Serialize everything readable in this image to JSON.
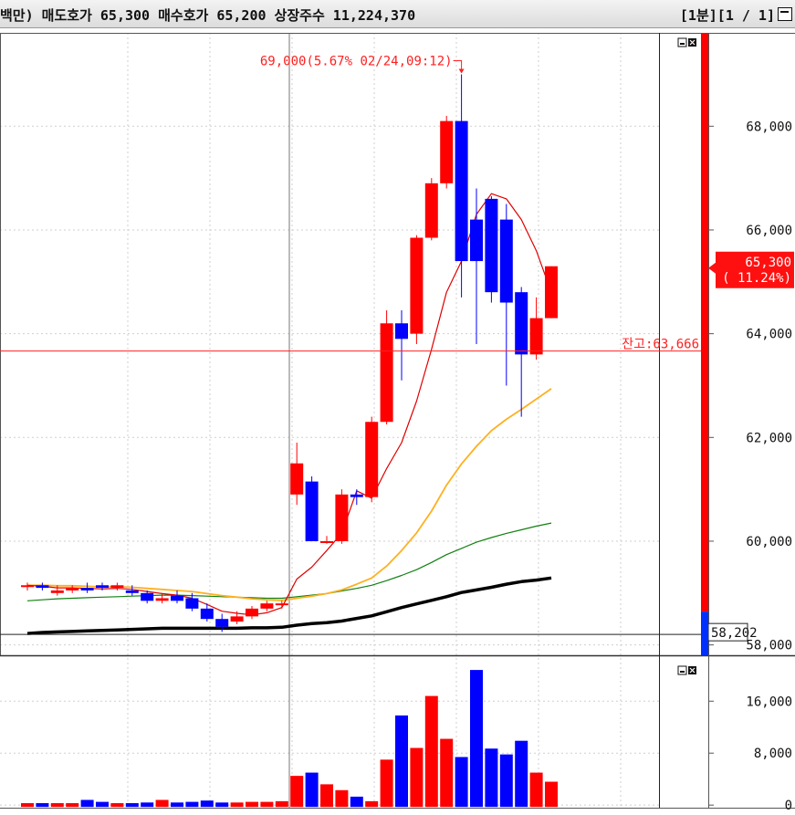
{
  "header": {
    "info": "백만) 매도호가 65,300 매수호가 65,200 상장주수 11,224,370",
    "right": "[1분][1 / 1]"
  },
  "colors": {
    "up": "#ff0000",
    "down": "#0000ff",
    "ma5": "#e00000",
    "ma20": "#ffb020",
    "ma60": "#108010",
    "ma120": "#000000"
  },
  "chart_data": [
    {
      "type": "candlestick",
      "x": [
        1,
        2,
        3,
        4,
        5,
        6,
        7,
        8,
        9,
        10,
        11,
        12,
        13,
        14,
        15,
        16,
        17,
        18,
        19,
        20,
        21,
        22,
        23,
        24,
        25,
        26,
        27,
        28,
        29,
        30,
        31,
        32,
        33,
        34,
        35,
        36
      ],
      "open": [
        59150,
        59150,
        59000,
        59050,
        59100,
        59150,
        59100,
        59050,
        59000,
        58850,
        58950,
        58900,
        58700,
        58500,
        58450,
        58550,
        58700,
        58800,
        60900,
        61150,
        60000,
        60000,
        60900,
        60850,
        62300,
        64200,
        64000,
        65850,
        66900,
        68100,
        66200,
        66600,
        66200,
        64800,
        63600,
        64300
      ],
      "close": [
        59150,
        59100,
        59050,
        59100,
        59050,
        59100,
        59150,
        59000,
        58850,
        58900,
        58850,
        58700,
        58500,
        58350,
        58550,
        58700,
        58800,
        58800,
        61500,
        60000,
        60000,
        60900,
        60850,
        62300,
        64200,
        63900,
        65850,
        66900,
        68100,
        65400,
        65400,
        64800,
        64600,
        63600,
        64300,
        65300
      ],
      "high": [
        59200,
        59200,
        59150,
        59150,
        59200,
        59200,
        59200,
        59150,
        59050,
        59000,
        59050,
        59000,
        58800,
        58600,
        58650,
        58750,
        58850,
        58850,
        61900,
        61250,
        60100,
        61000,
        61000,
        62400,
        64450,
        64450,
        65900,
        67000,
        68200,
        69000,
        66800,
        66650,
        66500,
        64900,
        64700,
        65300
      ],
      "low": [
        59050,
        59050,
        58950,
        59000,
        59000,
        59050,
        59050,
        58950,
        58800,
        58800,
        58800,
        58650,
        58450,
        58250,
        58400,
        58500,
        58650,
        58700,
        60700,
        60000,
        59950,
        59950,
        60700,
        60750,
        62250,
        63100,
        63800,
        65800,
        66800,
        64700,
        63800,
        64600,
        63000,
        62400,
        63500,
        64300
      ],
      "ma5": [
        59150,
        59130,
        59100,
        59100,
        59090,
        59080,
        59090,
        59070,
        59030,
        58990,
        58960,
        58900,
        58780,
        58650,
        58610,
        58580,
        58620,
        58720,
        59270,
        59500,
        59820,
        60150,
        60970,
        60830,
        61400,
        61900,
        62700,
        63700,
        64800,
        65400,
        66300,
        66700,
        66600,
        66200,
        65600,
        64800
      ],
      "ma20": [
        59150,
        59150,
        59140,
        59140,
        59130,
        59120,
        59120,
        59110,
        59090,
        59070,
        59050,
        59030,
        58990,
        58950,
        58920,
        58890,
        58870,
        58860,
        58900,
        58940,
        58990,
        59060,
        59170,
        59290,
        59520,
        59820,
        60160,
        60580,
        61080,
        61490,
        61830,
        62130,
        62350,
        62540,
        62740,
        62940
      ],
      "ma60": [
        58850,
        58870,
        58890,
        58900,
        58910,
        58920,
        58930,
        58940,
        58950,
        58960,
        58960,
        58950,
        58940,
        58930,
        58920,
        58910,
        58900,
        58900,
        58930,
        58960,
        58990,
        59040,
        59090,
        59150,
        59240,
        59340,
        59450,
        59590,
        59740,
        59860,
        59980,
        60070,
        60150,
        60220,
        60290,
        60350
      ],
      "ma120": [
        58220,
        58240,
        58250,
        58260,
        58270,
        58280,
        58290,
        58300,
        58310,
        58320,
        58320,
        58320,
        58320,
        58320,
        58320,
        58330,
        58330,
        58340,
        58380,
        58410,
        58430,
        58460,
        58510,
        58560,
        58640,
        58720,
        58790,
        58860,
        58930,
        59010,
        59060,
        59110,
        59170,
        59220,
        59250,
        59290
      ],
      "ylim": [
        57800,
        69800
      ],
      "yticks": [
        "68,000",
        "66,000",
        "64,000",
        "62,000",
        "60,000",
        "58,000"
      ],
      "max_annotation": "69,000(5.67% 02/24,09:12)",
      "balance_label": "잔고:63,666",
      "balance_value": 63666,
      "current_price": "65,300",
      "current_change": "( 11.24%)",
      "current_value": 65300,
      "crosshair_label": "58,202",
      "crosshair_value": 58202
    },
    {
      "type": "bar",
      "x": [
        1,
        2,
        3,
        4,
        5,
        6,
        7,
        8,
        9,
        10,
        11,
        12,
        13,
        14,
        15,
        16,
        17,
        18,
        19,
        20,
        21,
        22,
        23,
        24,
        25,
        26,
        27,
        28,
        29,
        30,
        31,
        32,
        33,
        34,
        35,
        36
      ],
      "values": [
        300,
        300,
        300,
        300,
        800,
        500,
        300,
        300,
        400,
        800,
        400,
        500,
        700,
        400,
        400,
        500,
        500,
        600,
        4500,
        5000,
        3200,
        2300,
        1300,
        600,
        7000,
        13800,
        8800,
        16800,
        10200,
        7400,
        20800,
        8700,
        7800,
        9900,
        5000,
        3600
      ],
      "ylim": [
        -400,
        22500
      ],
      "yticks": [
        "16,000",
        "8,000",
        "0"
      ]
    }
  ]
}
